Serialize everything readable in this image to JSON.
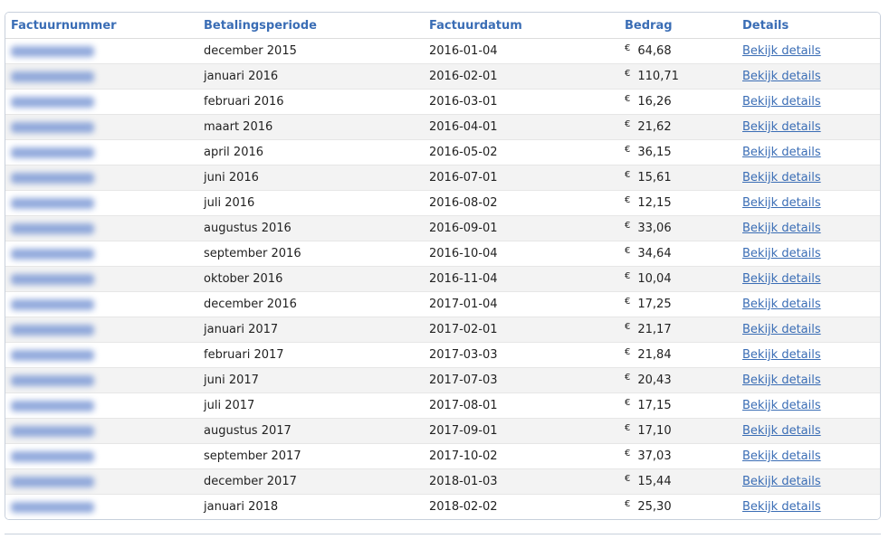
{
  "table": {
    "headers": [
      "Factuurnummer",
      "Betalingsperiode",
      "Factuurdatum",
      "Bedrag",
      "Details"
    ],
    "currency": "€",
    "details_label": "Bekijk details",
    "rows": [
      {
        "period": "december 2015",
        "date": "2016-01-04",
        "amount": "64,68"
      },
      {
        "period": "januari 2016",
        "date": "2016-02-01",
        "amount": "110,71"
      },
      {
        "period": "februari 2016",
        "date": "2016-03-01",
        "amount": "16,26"
      },
      {
        "period": "maart 2016",
        "date": "2016-04-01",
        "amount": "21,62"
      },
      {
        "period": "april 2016",
        "date": "2016-05-02",
        "amount": "36,15"
      },
      {
        "period": "juni 2016",
        "date": "2016-07-01",
        "amount": "15,61"
      },
      {
        "period": "juli 2016",
        "date": "2016-08-02",
        "amount": "12,15"
      },
      {
        "period": "augustus 2016",
        "date": "2016-09-01",
        "amount": "33,06"
      },
      {
        "period": "september 2016",
        "date": "2016-10-04",
        "amount": "34,64"
      },
      {
        "period": "oktober 2016",
        "date": "2016-11-04",
        "amount": "10,04"
      },
      {
        "period": "december 2016",
        "date": "2017-01-04",
        "amount": "17,25"
      },
      {
        "period": "januari 2017",
        "date": "2017-02-01",
        "amount": "21,17"
      },
      {
        "period": "februari 2017",
        "date": "2017-03-03",
        "amount": "21,84"
      },
      {
        "period": "juni 2017",
        "date": "2017-07-03",
        "amount": "20,43"
      },
      {
        "period": "juli 2017",
        "date": "2017-08-01",
        "amount": "17,15"
      },
      {
        "period": "augustus 2017",
        "date": "2017-09-01",
        "amount": "17,10"
      },
      {
        "period": "september 2017",
        "date": "2017-10-02",
        "amount": "37,03"
      },
      {
        "period": "december 2017",
        "date": "2018-01-03",
        "amount": "15,44"
      },
      {
        "period": "januari 2018",
        "date": "2018-02-02",
        "amount": "25,30"
      }
    ]
  }
}
